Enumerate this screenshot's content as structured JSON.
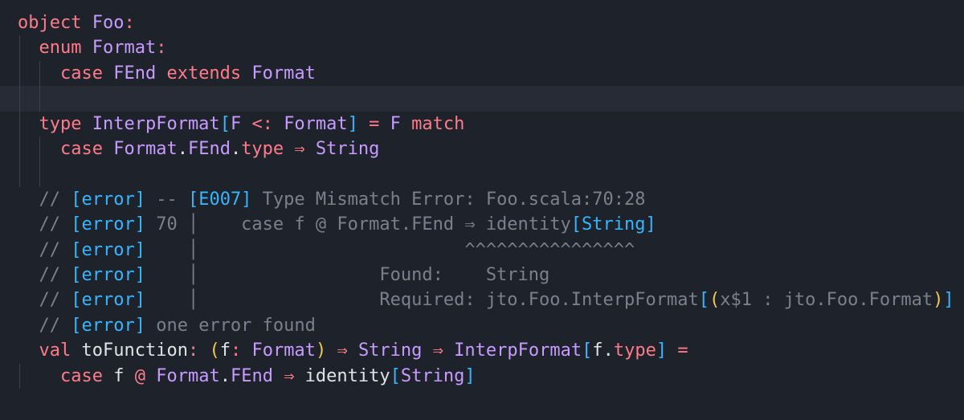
{
  "editor": {
    "lines": [
      [
        [
          "kw",
          "object"
        ],
        [
          "plain",
          " "
        ],
        [
          "ty",
          "Foo"
        ],
        [
          "kw",
          ":"
        ]
      ],
      [
        [
          "plain",
          "  "
        ],
        [
          "kw",
          "enum"
        ],
        [
          "plain",
          " "
        ],
        [
          "ty",
          "Format"
        ],
        [
          "kw",
          ":"
        ]
      ],
      [
        [
          "plain",
          "    "
        ],
        [
          "kw",
          "case"
        ],
        [
          "plain",
          " "
        ],
        [
          "ty",
          "FEnd"
        ],
        [
          "plain",
          " "
        ],
        [
          "kw",
          "extends"
        ],
        [
          "plain",
          " "
        ],
        [
          "ty",
          "Format"
        ]
      ],
      [],
      [
        [
          "plain",
          "  "
        ],
        [
          "kw",
          "type"
        ],
        [
          "plain",
          " "
        ],
        [
          "ty",
          "InterpFormat"
        ],
        [
          "br",
          "["
        ],
        [
          "ty",
          "F"
        ],
        [
          "plain",
          " "
        ],
        [
          "op",
          "<:"
        ],
        [
          "plain",
          " "
        ],
        [
          "ty",
          "Format"
        ],
        [
          "br",
          "]"
        ],
        [
          "plain",
          " "
        ],
        [
          "op",
          "="
        ],
        [
          "plain",
          " "
        ],
        [
          "ty",
          "F"
        ],
        [
          "plain",
          " "
        ],
        [
          "kw",
          "match"
        ]
      ],
      [
        [
          "plain",
          "    "
        ],
        [
          "kw",
          "case"
        ],
        [
          "plain",
          " "
        ],
        [
          "ty",
          "Format"
        ],
        [
          "plain",
          "."
        ],
        [
          "ty",
          "FEnd"
        ],
        [
          "plain",
          "."
        ],
        [
          "kw",
          "type"
        ],
        [
          "plain",
          " "
        ],
        [
          "op",
          "⇒"
        ],
        [
          "plain",
          " "
        ],
        [
          "ty",
          "String"
        ]
      ],
      [],
      [
        [
          "plain",
          "  "
        ],
        [
          "cm",
          "// "
        ],
        [
          "br",
          "[error]"
        ],
        [
          "cm",
          " -- "
        ],
        [
          "br",
          "[E007]"
        ],
        [
          "cm",
          " Type Mismatch Error: Foo.scala:70:28"
        ]
      ],
      [
        [
          "plain",
          "  "
        ],
        [
          "cm",
          "// "
        ],
        [
          "br",
          "[error]"
        ],
        [
          "cm",
          " 70 │    case f @ Format.FEnd ⇒ identity"
        ],
        [
          "br",
          "[String]"
        ]
      ],
      [
        [
          "plain",
          "  "
        ],
        [
          "cm",
          "// "
        ],
        [
          "br",
          "[error]"
        ],
        [
          "cm",
          "    │                         ^^^^^^^^^^^^^^^^"
        ]
      ],
      [
        [
          "plain",
          "  "
        ],
        [
          "cm",
          "// "
        ],
        [
          "br",
          "[error]"
        ],
        [
          "cm",
          "    │                 Found:    String"
        ]
      ],
      [
        [
          "plain",
          "  "
        ],
        [
          "cm",
          "// "
        ],
        [
          "br",
          "[error]"
        ],
        [
          "cm",
          "    │                 Required: jto.Foo.InterpFormat"
        ],
        [
          "br",
          "["
        ],
        [
          "br2",
          "("
        ],
        [
          "cm",
          "x$1 : jto.Foo.Format"
        ],
        [
          "br2",
          ")"
        ],
        [
          "br",
          "]"
        ]
      ],
      [
        [
          "plain",
          "  "
        ],
        [
          "cm",
          "// "
        ],
        [
          "br",
          "[error]"
        ],
        [
          "cm",
          " one error found"
        ]
      ],
      [
        [
          "plain",
          "  "
        ],
        [
          "kw",
          "val"
        ],
        [
          "plain",
          " toFunction"
        ],
        [
          "kw",
          ":"
        ],
        [
          "plain",
          " "
        ],
        [
          "br2",
          "("
        ],
        [
          "plain",
          "f"
        ],
        [
          "kw",
          ":"
        ],
        [
          "plain",
          " "
        ],
        [
          "ty",
          "Format"
        ],
        [
          "br2",
          ")"
        ],
        [
          "plain",
          " "
        ],
        [
          "op",
          "⇒"
        ],
        [
          "plain",
          " "
        ],
        [
          "ty",
          "String"
        ],
        [
          "plain",
          " "
        ],
        [
          "op",
          "⇒"
        ],
        [
          "plain",
          " "
        ],
        [
          "ty",
          "InterpFormat"
        ],
        [
          "br",
          "["
        ],
        [
          "plain",
          "f."
        ],
        [
          "kw",
          "type"
        ],
        [
          "br",
          "]"
        ],
        [
          "plain",
          " "
        ],
        [
          "op",
          "="
        ]
      ],
      [
        [
          "plain",
          "    "
        ],
        [
          "kw",
          "case"
        ],
        [
          "plain",
          " f "
        ],
        [
          "op",
          "@"
        ],
        [
          "plain",
          " "
        ],
        [
          "ty",
          "Format"
        ],
        [
          "plain",
          "."
        ],
        [
          "ty",
          "FEnd"
        ],
        [
          "plain",
          " "
        ],
        [
          "op",
          "⇒"
        ],
        [
          "plain",
          " identity"
        ],
        [
          "br",
          "["
        ],
        [
          "ty",
          "String"
        ],
        [
          "br",
          "]"
        ]
      ]
    ],
    "colors": {
      "background": "#1e222a",
      "current_line": "#262b35",
      "keyword": "#ff7b8a",
      "type": "#c79bff",
      "bracket": "#35b6ff",
      "paren": "#f2c94c",
      "comment": "#7a818d",
      "plain": "#dfe3ea"
    }
  }
}
